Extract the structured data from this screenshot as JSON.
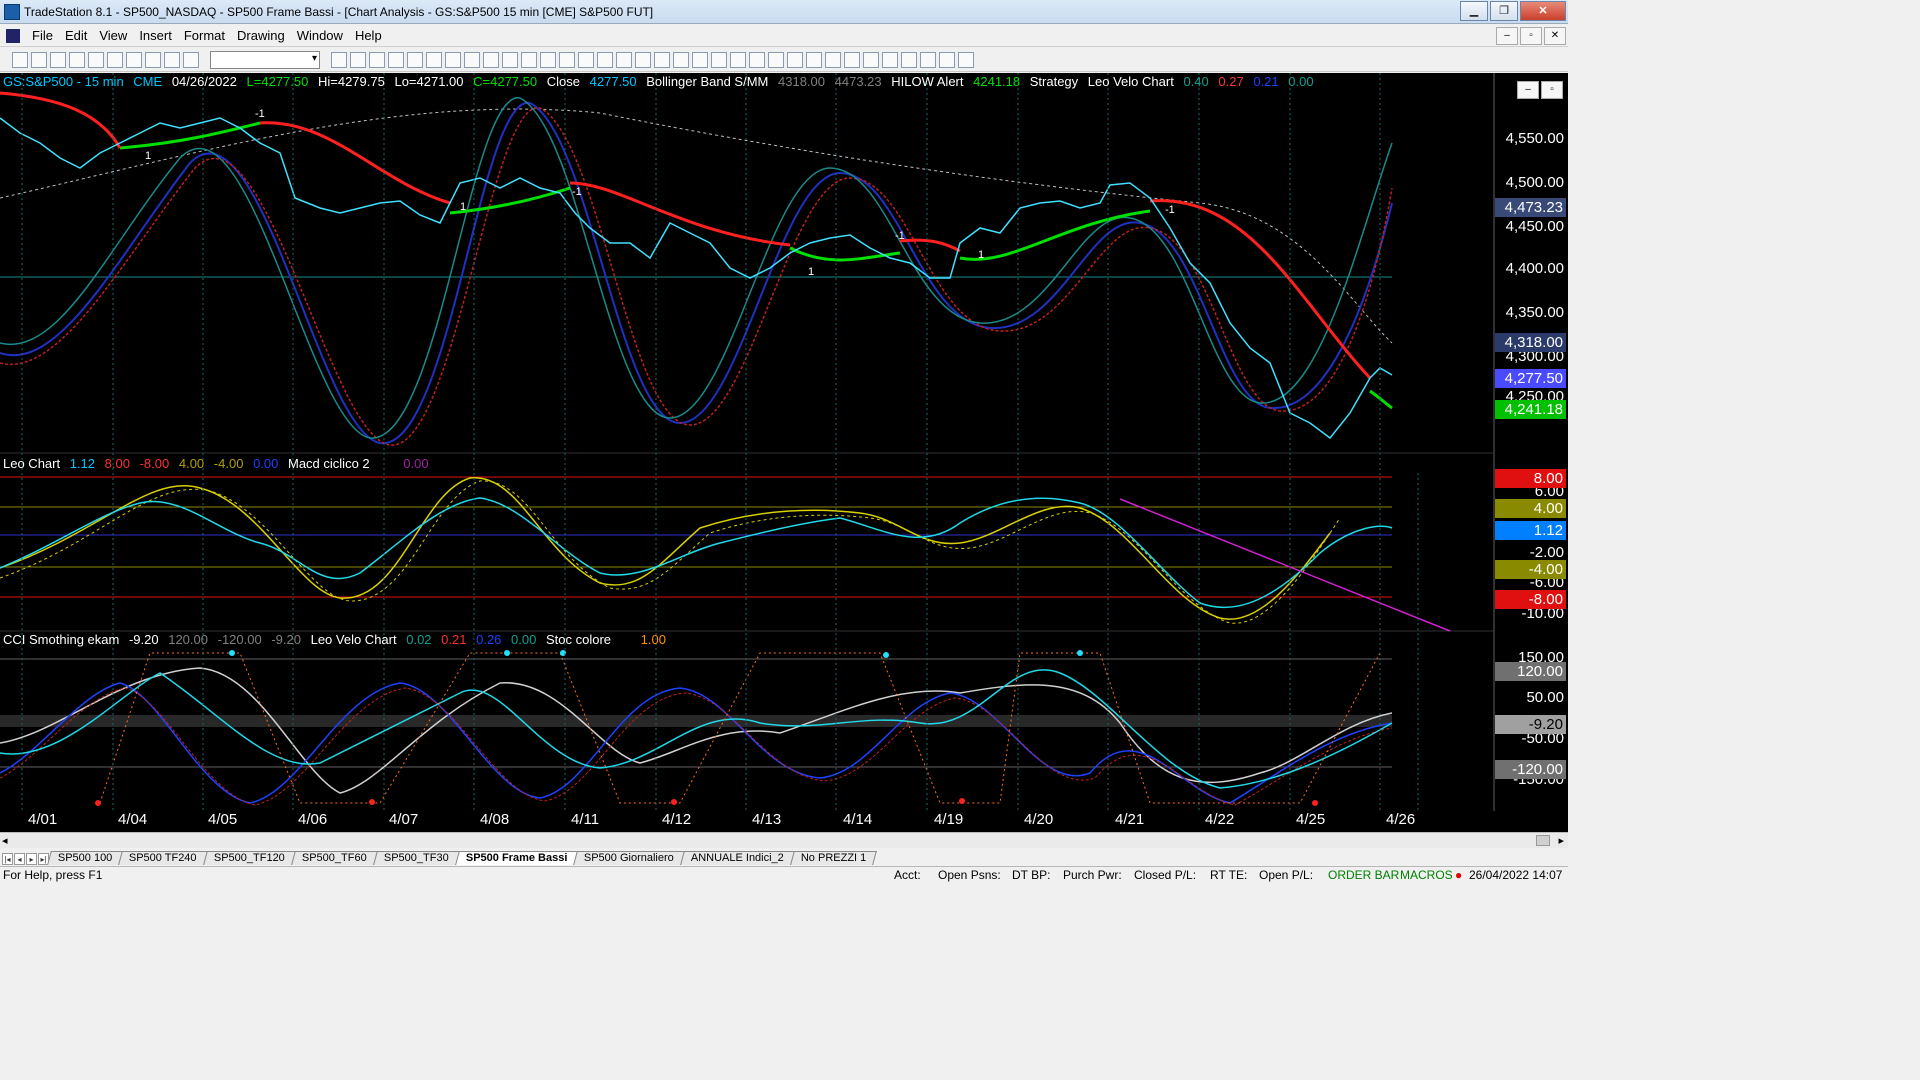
{
  "window": {
    "title": "TradeStation 8.1 - SP500_NASDAQ - SP500 Frame Bassi - [Chart Analysis - GS:S&P500  15 min  [CME] S&P500 FUT]",
    "minimize": "▁",
    "restore": "❐",
    "close": "✕"
  },
  "menu": {
    "items": [
      "File",
      "Edit",
      "View",
      "Insert",
      "Format",
      "Drawing",
      "Window",
      "Help"
    ],
    "mdi_minimize": "–",
    "mdi_restore": "▫",
    "mdi_close": "✕"
  },
  "toolbar": {
    "symbol_combo_value": ""
  },
  "price_pane": {
    "header": {
      "symbol": "GS:S&P500 - 15 min",
      "exchange": "CME",
      "date": "04/26/2022",
      "last": "L=4277.50",
      "high": "Hi=4279.75",
      "low": "Lo=4271.00",
      "close": "C=4277.50",
      "close_label": "Close",
      "close_value": "4277.50",
      "bb_label": "Bollinger Band S/MM",
      "bb_v1": "4318.00",
      "bb_v2": "4473.23",
      "hilow_label": "HILOW Alert",
      "hilow_value": "4241.18",
      "strategy_label": "Strategy",
      "leo_label": "Leo Velo Chart",
      "leo_v1": "0.40",
      "leo_v2": "0.27",
      "leo_v3": "0.21",
      "leo_v4": "0.00"
    },
    "y_ticks": [
      "4,550.00",
      "4,500.00",
      "4,450.00",
      "4,400.00",
      "4,350.00",
      "4,300.00",
      "4,250.00"
    ],
    "badges": [
      {
        "value": "4,473.23",
        "bg": "#3a4a78",
        "color": "#ffffff"
      },
      {
        "value": "4,318.00",
        "bg": "#2a3a6a",
        "color": "#ffffff"
      },
      {
        "value": "4,277.50",
        "bg": "#4a4aff",
        "color": "#ffffff"
      },
      {
        "value": "4,241.18",
        "bg": "#00c000",
        "color": "#ffffff"
      }
    ]
  },
  "leo_pane": {
    "header": {
      "label": "Leo Chart",
      "v1": "1.12",
      "v2": "8.00",
      "v3": "-8.00",
      "v4": "4.00",
      "v5": "-4.00",
      "v6": "0.00",
      "macd_label": "Macd ciclico 2",
      "macd_value": "0.00"
    },
    "y_ticks": [
      "6.00",
      "-2.00",
      "-6.00",
      "-10.00"
    ],
    "badges": [
      {
        "value": "8.00",
        "bg": "#e01010",
        "color": "#ffffff"
      },
      {
        "value": "4.00",
        "bg": "#8a8a00",
        "color": "#ffffff"
      },
      {
        "value": "1.12",
        "bg": "#0080ff",
        "color": "#ffffff"
      },
      {
        "value": "-4.00",
        "bg": "#8a8a00",
        "color": "#ffffff"
      },
      {
        "value": "-8.00",
        "bg": "#e01010",
        "color": "#ffffff"
      }
    ]
  },
  "cci_pane": {
    "header": {
      "label": "CCI Smothing ekam",
      "v1": "-9.20",
      "v2": "120.00",
      "v3": "-120.00",
      "v4": "-9.20",
      "leo_label": "Leo Velo Chart",
      "leo_v1": "0.02",
      "leo_v2": "0.21",
      "leo_v3": "0.26",
      "leo_v4": "0.00",
      "stoc_label": "Stoc colore",
      "stoc_value": "1.00"
    },
    "y_ticks": [
      "150.00",
      "50.00",
      "-50.00",
      "-150.00"
    ],
    "badges": [
      {
        "value": "120.00",
        "bg": "#707070",
        "color": "#ffffff"
      },
      {
        "value": "-9.20",
        "bg": "#a0a0a0",
        "color": "#000000"
      },
      {
        "value": "-120.00",
        "bg": "#707070",
        "color": "#ffffff"
      }
    ]
  },
  "x_axis": [
    "4/01",
    "4/04",
    "4/05",
    "4/06",
    "4/07",
    "4/08",
    "4/11",
    "4/12",
    "4/13",
    "4/14",
    "4/19",
    "4/20",
    "4/21",
    "4/22",
    "4/25",
    "4/26"
  ],
  "tabs": {
    "items": [
      "SP500 100",
      "SP500 TF240",
      "SP500_TF120",
      "SP500_TF60",
      "SP500_TF30",
      "SP500 Frame Bassi",
      "SP500 Giornaliero",
      "ANNUALE Indici_2",
      "No PREZZI 1"
    ],
    "active_index": 5
  },
  "status": {
    "help": "For Help, press F1",
    "acct": "Acct:",
    "open_psns": "Open Psns:",
    "dt_bp": "DT BP:",
    "purch_pwr": "Purch Pwr:",
    "closed_pl": "Closed P/L:",
    "rt_te": "RT TE:",
    "open_pl": "Open P/L:",
    "order_bar": "ORDER BAR",
    "macros": "MACROS",
    "datetime": "26/04/2022 14:07"
  }
}
